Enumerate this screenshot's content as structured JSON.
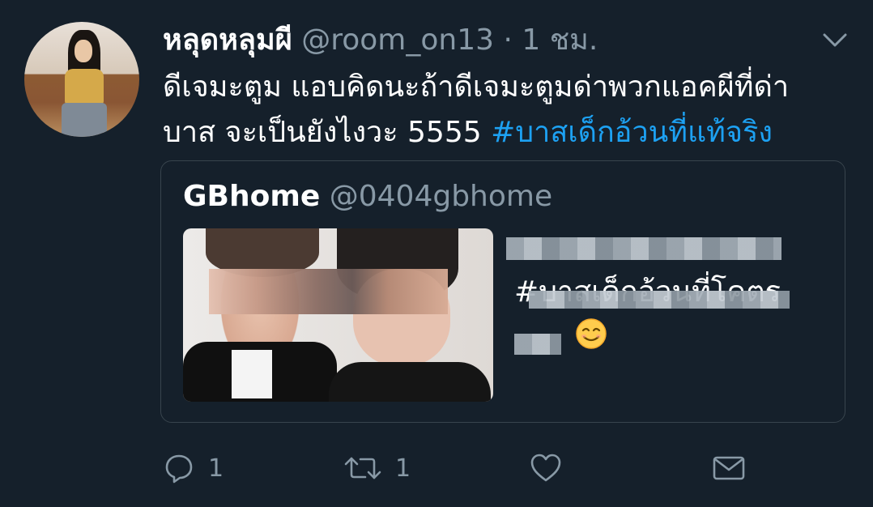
{
  "tweet": {
    "name": "หลุดหลุมผี",
    "handle": "@room_on13",
    "separator": "·",
    "time": "1 ชม.",
    "text_line1": "ดีเจมะตูม แอบคิดนะถ้าดีเจมะตูมด่าพวกแอคผีที่ด่า",
    "text_line2_plain": "บาส จะเป็นยังไงวะ 5555 ",
    "hashtag": "#บาสเด็กอ้วนที่แท้จริง"
  },
  "quote": {
    "name": "GBhome",
    "handle": "@0404gbhome",
    "text_line2": "#บาสเด็กอ้วนที่โคตร",
    "emoji": "smiling-face-emoji"
  },
  "actions": {
    "reply_count": "1",
    "retweet_count": "1"
  },
  "icons": {
    "menu": "chevron-down-icon",
    "reply": "reply-icon",
    "retweet": "retweet-icon",
    "like": "heart-icon",
    "share": "mail-icon"
  },
  "colors": {
    "background": "#15202b",
    "text_secondary": "#8899a6",
    "link": "#1da1f2",
    "border": "#38444d"
  }
}
